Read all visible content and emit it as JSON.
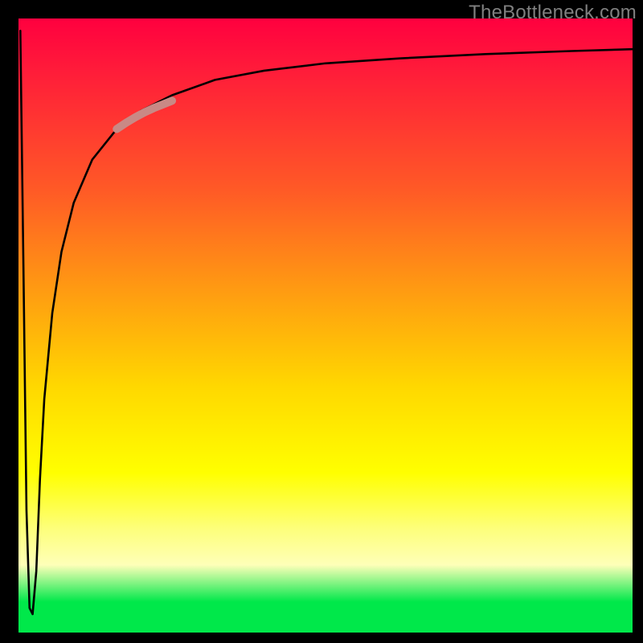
{
  "watermark": "TheBottleneck.com",
  "chart_data": {
    "type": "line",
    "title": "",
    "xlabel": "",
    "ylabel": "",
    "xlim": [
      0,
      100
    ],
    "ylim": [
      0,
      100
    ],
    "grid": false,
    "legend": false,
    "series": [
      {
        "name": "bottleneck-curve",
        "color": "#000000",
        "x": [
          0.3,
          0.8,
          1.3,
          1.8,
          2.3,
          2.9,
          3.5,
          4.2,
          5.5,
          7,
          9,
          12,
          16,
          20,
          25,
          32,
          40,
          50,
          62,
          76,
          90,
          100
        ],
        "y": [
          98,
          60,
          20,
          4,
          3,
          10,
          25,
          38,
          52,
          62,
          70,
          77,
          82,
          85,
          87.5,
          90,
          91.5,
          92.7,
          93.5,
          94.2,
          94.7,
          95
        ]
      },
      {
        "name": "highlight-segment",
        "color": "#c98985",
        "thick": true,
        "x": [
          16,
          17.5,
          19,
          20.5,
          22,
          23.5,
          25
        ],
        "y": [
          82,
          83,
          83.9,
          84.7,
          85.4,
          86,
          86.6
        ]
      }
    ]
  }
}
